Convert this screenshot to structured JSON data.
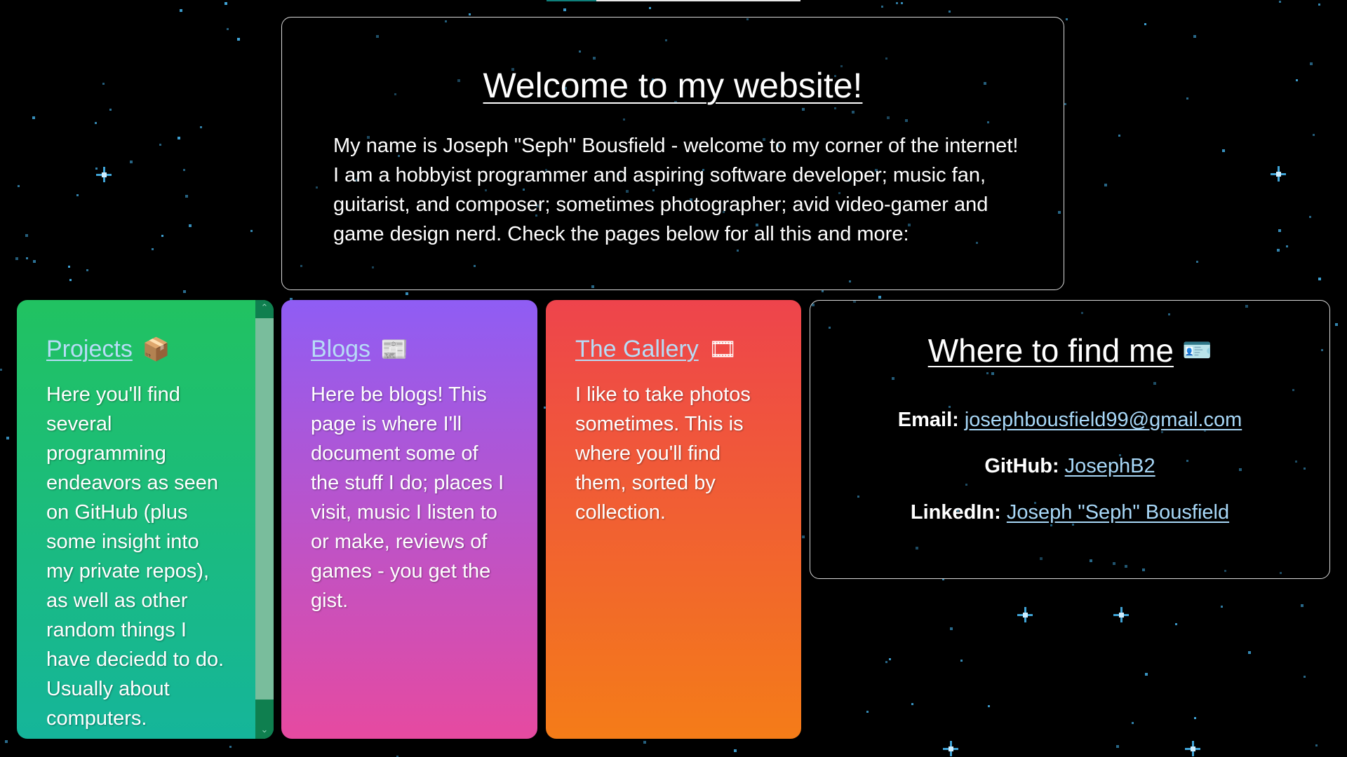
{
  "welcome": {
    "title": "Welcome to my website!",
    "intro": "My name is Joseph \"Seph\" Bousfield - welcome to my corner of the internet! I am a hobbyist programmer and aspiring software developer; music fan, guitarist, and composer; sometimes photographer; avid video-gamer and game design nerd. Check the pages below for all this and more:"
  },
  "cards": {
    "projects": {
      "title": "Projects",
      "icon": "package-icon",
      "emoji": "📦",
      "description": "Here you'll find several programming endeavors as seen on GitHub (plus some insight into my private repos), as well as other random things I have deciedd to do. Usually about computers."
    },
    "blogs": {
      "title": "Blogs",
      "icon": "newspaper-icon",
      "emoji": "📰",
      "description": "Here be blogs! This page is where I'll document some of the stuff I do; places I visit, music I listen to or make, reviews of games - you get the gist."
    },
    "gallery": {
      "title": "The Gallery",
      "icon": "film-frames-icon",
      "emoji": "🎞",
      "description": "I like to take photos sometimes. This is where you'll find them, sorted by collection."
    }
  },
  "contact": {
    "title": "Where to find me",
    "icon": "id-card-icon",
    "emoji": "🪪",
    "email_label": "Email:",
    "email_value": "josephbousfield99@gmail.com",
    "github_label": "GitHub:",
    "github_value": "JosephB2",
    "linkedin_label": "LinkedIn:",
    "linkedin_value": "Joseph \"Seph\" Bousfield"
  },
  "scrollbar": {
    "up_glyph": "⌃",
    "down_glyph": "⌄"
  },
  "colors": {
    "background": "#000000",
    "star": "#3fa3d6",
    "link": "#a8d8f8",
    "projects_gradient": [
      "#21c261",
      "#15b59a"
    ],
    "blogs_gradient": [
      "#8f5df4",
      "#e64aa0"
    ],
    "gallery_gradient": [
      "#ee444c",
      "#f47c18"
    ]
  }
}
